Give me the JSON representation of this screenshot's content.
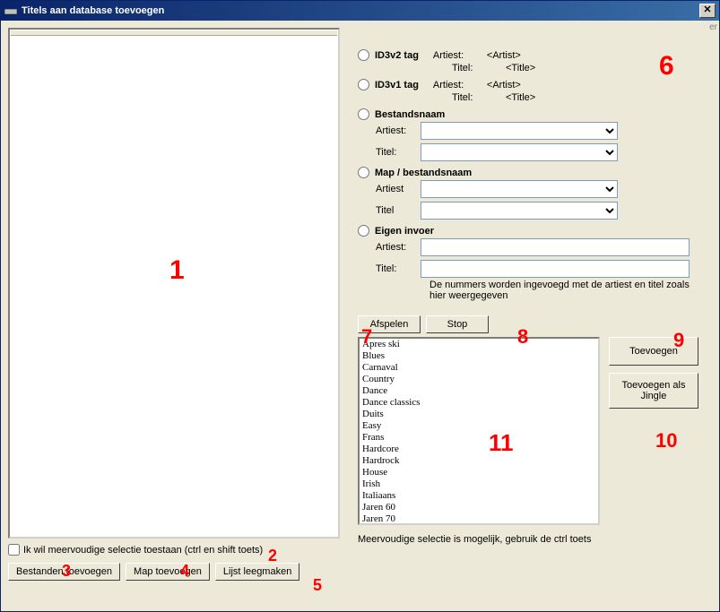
{
  "window": {
    "title": "Titels aan database toevoegen",
    "close_glyph": "✕",
    "ev": "er"
  },
  "left": {
    "checkbox_label": "Ik wil meervoudige selectie toestaan (ctrl en shift toets)",
    "btn_files": "Bestanden toevoegen",
    "btn_folder": "Map toevoegen",
    "btn_clear": "Lijst leegmaken"
  },
  "right": {
    "id3v2": {
      "label": "ID3v2 tag",
      "artist_lbl": "Artiest:",
      "artist_val": "<Artist>",
      "title_lbl": "Titel:",
      "title_val": "<Title>"
    },
    "id3v1": {
      "label": "ID3v1 tag",
      "artist_lbl": "Artiest:",
      "artist_val": "<Artist>",
      "title_lbl": "Titel:",
      "title_val": "<Title>"
    },
    "filename": {
      "label": "Bestandsnaam",
      "artist_lbl": "Artiest:",
      "title_lbl": "Titel:"
    },
    "folder": {
      "label": "Map / bestandsnaam",
      "artist_lbl": "Artiest",
      "title_lbl": "Titel"
    },
    "own": {
      "label": "Eigen invoer",
      "artist_lbl": "Artiest:",
      "title_lbl": "Titel:",
      "hint": "De nummers worden ingevoegd met de artiest en titel zoals hier weergegeven"
    },
    "btn_play": "Afspelen",
    "btn_stop": "Stop",
    "btn_add": "Toevoegen",
    "btn_add_jingle": "Toevoegen als Jingle",
    "multi_hint": "Meervoudige selectie is mogelijk, gebruik de ctrl toets"
  },
  "genres": [
    "Apres ski",
    "Blues",
    "Carnaval",
    "Country",
    "Dance",
    "Dance classics",
    "Duits",
    "Easy",
    "Frans",
    "Hardcore",
    "Hardrock",
    "House",
    "Irish",
    "Italiaans",
    "Jaren 60",
    "Jaren 70"
  ],
  "annotations": {
    "a1": "1",
    "a2": "2",
    "a3": "3",
    "a4": "4",
    "a5": "5",
    "a6": "6",
    "a7": "7",
    "a8": "8",
    "a9": "9",
    "a10": "10",
    "a11": "11"
  }
}
